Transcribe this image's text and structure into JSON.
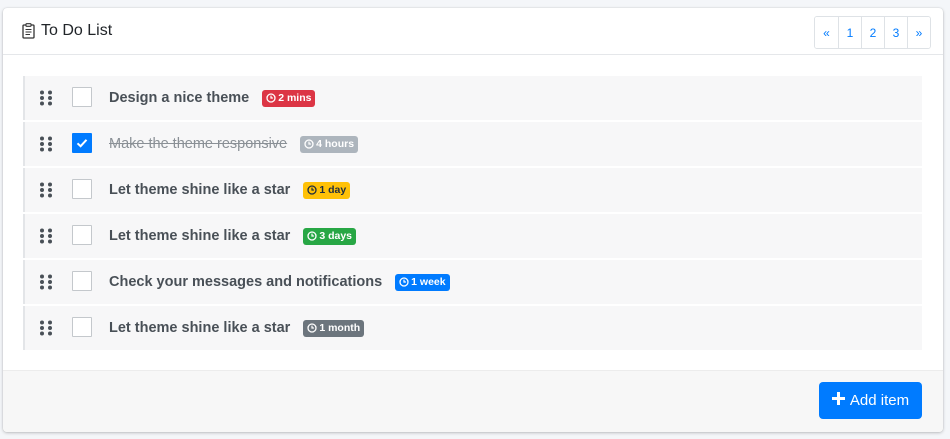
{
  "header": {
    "title": "To Do List",
    "title_icon": "clipboard-list-icon"
  },
  "pagination": {
    "prev": "«",
    "pages": [
      "1",
      "2",
      "3"
    ],
    "next": "»"
  },
  "todos": [
    {
      "text": "Design a nice theme",
      "checked": false,
      "badge": "2 mins",
      "badge_color": "#dc3545",
      "badge_text_color": "#ffffff"
    },
    {
      "text": "Make the theme responsive",
      "checked": true,
      "badge": "4 hours",
      "badge_color": "#adb5bd",
      "badge_text_color": "#ffffff"
    },
    {
      "text": "Let theme shine like a star",
      "checked": false,
      "badge": "1 day",
      "badge_color": "#ffc107",
      "badge_text_color": "#1f2d3d"
    },
    {
      "text": "Let theme shine like a star",
      "checked": false,
      "badge": "3 days",
      "badge_color": "#28a745",
      "badge_text_color": "#ffffff"
    },
    {
      "text": "Check your messages and notifications",
      "checked": false,
      "badge": "1 week",
      "badge_color": "#007bff",
      "badge_text_color": "#ffffff"
    },
    {
      "text": "Let theme shine like a star",
      "checked": false,
      "badge": "1 month",
      "badge_color": "#6c757d",
      "badge_text_color": "#ffffff"
    }
  ],
  "footer": {
    "add_label": "Add item",
    "add_icon": "plus-icon"
  },
  "colors": {
    "accent": "#007bff"
  }
}
